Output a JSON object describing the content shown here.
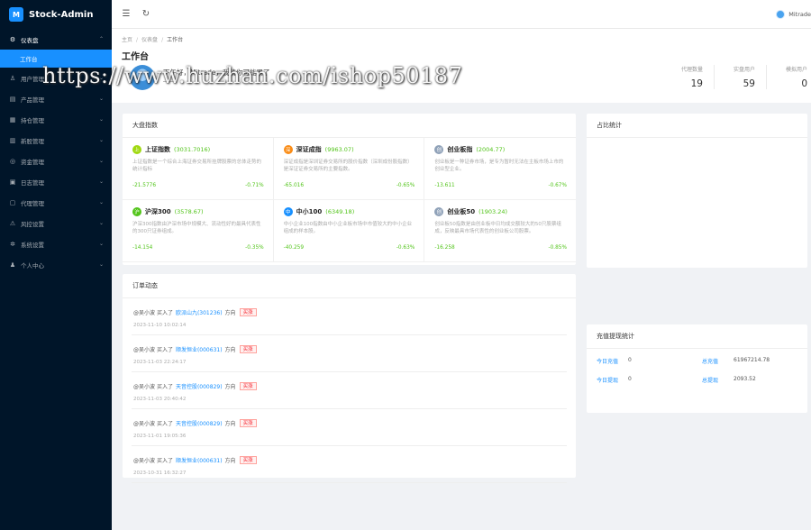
{
  "app": {
    "title": "Stock-Admin",
    "logo_glyph": "M"
  },
  "sidebar": {
    "dashboard": {
      "label": "仪表盘",
      "icon": "dashboard-icon"
    },
    "active_sub": {
      "label": "工作台"
    },
    "items": [
      {
        "label": "用户管理",
        "icon": "user-icon"
      },
      {
        "label": "产品管理",
        "icon": "product-icon"
      },
      {
        "label": "持仓管理",
        "icon": "position-icon"
      },
      {
        "label": "新股管理",
        "icon": "ipo-icon"
      },
      {
        "label": "资金管理",
        "icon": "fund-icon"
      },
      {
        "label": "日志管理",
        "icon": "log-icon"
      },
      {
        "label": "代理管理",
        "icon": "agent-icon"
      },
      {
        "label": "风控设置",
        "icon": "risk-icon"
      },
      {
        "label": "系统设置",
        "icon": "settings-icon"
      },
      {
        "label": "个人中心",
        "icon": "person-icon"
      }
    ]
  },
  "header": {
    "username": "Mitrade"
  },
  "breadcrumb": [
    "主页",
    "仪表盘",
    "工作台"
  ],
  "page": {
    "title": "工作台",
    "greeting": "下午好，Mitrade，我猜你可能累了",
    "stats": [
      {
        "label": "代理数量",
        "value": "19"
      },
      {
        "label": "实盘用户",
        "value": "59"
      },
      {
        "label": "模拟用户",
        "value": "0"
      }
    ]
  },
  "indices": {
    "title": "大盘指数",
    "items": [
      {
        "name": "上证指数",
        "value": "(3031.7016)",
        "desc": "上证指数是一个综合上海证券交易所挂牌股票的总体走势的统计指标",
        "change": "-21.5776",
        "pct": "-0.71%",
        "badge_color": "#a0d911",
        "glyph": "上"
      },
      {
        "name": "深证成指",
        "value": "(9963.07)",
        "desc": "深证成指是深圳证券交易所的股价指数（深圳成份股指数）是深证证券交易所的主要指数。",
        "change": "-65.016",
        "pct": "-0.65%",
        "badge_color": "#fa8c16",
        "glyph": "深"
      },
      {
        "name": "创业板指",
        "value": "(2004.77)",
        "desc": "创业板是一种证券市场，是专为暂时无法在主板市场上市的创业型企业。",
        "change": "-13.611",
        "pct": "-0.67%",
        "badge_color": "#8fa1b8",
        "glyph": "创"
      },
      {
        "name": "沪深300",
        "value": "(3578.67)",
        "desc": "沪深300指数由沪深市场中规模大、流动性好的最具代表性的300只证券组成。",
        "change": "-14.154",
        "pct": "-0.35%",
        "badge_color": "#52c41a",
        "glyph": "沪"
      },
      {
        "name": "中小100",
        "value": "(6349.18)",
        "desc": "中小企业100指数由中小企业板市场中市值较大的中小企业组成的样本股。",
        "change": "-40.259",
        "pct": "-0.63%",
        "badge_color": "#1890ff",
        "glyph": "中"
      },
      {
        "name": "创业板50",
        "value": "(1903.24)",
        "desc": "创业板50指数是由创业板中日均成交额较大的50只股票组成，反映最具市场代表性的创业板公司股票。",
        "change": "-16.258",
        "pct": "-0.85%",
        "badge_color": "#8fa1b8",
        "glyph": "创"
      }
    ]
  },
  "share": {
    "title": "占比统计"
  },
  "orders": {
    "title": "订单动态",
    "items": [
      {
        "user": "@吴小波",
        "action": "买入了",
        "stock": "欧派山九(301236)",
        "dir": "方向",
        "tag": "买涨",
        "time": "2023-11-10 10:02:14"
      },
      {
        "user": "@吴小波",
        "action": "买入了",
        "stock": "顺发恒业(000631)",
        "dir": "方向",
        "tag": "买涨",
        "time": "2023-11-03 22:24:17"
      },
      {
        "user": "@吴小波",
        "action": "买入了",
        "stock": "天音控股(000829)",
        "dir": "方向",
        "tag": "买涨",
        "time": "2023-11-03 20:40:42"
      },
      {
        "user": "@吴小波",
        "action": "买入了",
        "stock": "天音控股(000829)",
        "dir": "方向",
        "tag": "买涨",
        "time": "2023-11-01 19:05:36"
      },
      {
        "user": "@吴小波",
        "action": "买入了",
        "stock": "顺发恒业(000631)",
        "dir": "方向",
        "tag": "买涨",
        "time": "2023-10-31 16:32:27"
      }
    ]
  },
  "funds": {
    "title": "充值提现统计",
    "items": [
      {
        "label": "今日充值",
        "value": "0"
      },
      {
        "label": "总充值",
        "value": "61967214.78"
      },
      {
        "label": "今日提现",
        "value": "0"
      },
      {
        "label": "总提现",
        "value": "2093.52"
      }
    ]
  },
  "watermark": "https://www.huzhan.com/ishop50187"
}
